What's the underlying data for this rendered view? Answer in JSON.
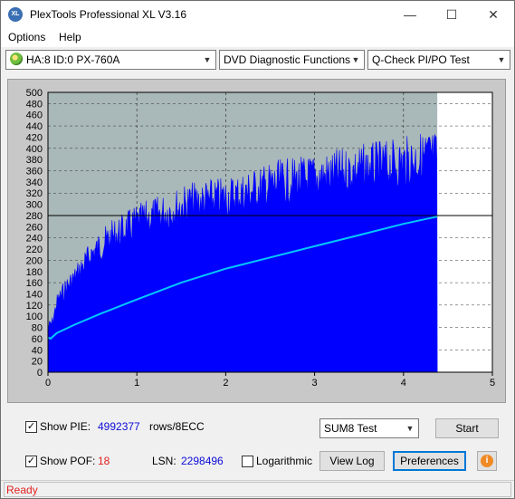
{
  "window": {
    "title": "PlexTools Professional XL V3.16",
    "icon_text": "XL",
    "minimize_glyph": "—",
    "maximize_glyph": "☐",
    "close_glyph": "✕"
  },
  "menu": {
    "items": [
      "Options",
      "Help"
    ]
  },
  "toolbar": {
    "drive": "HA:8 ID:0  PX-760A",
    "function": "DVD Diagnostic Functions",
    "test": "Q-Check PI/PO Test"
  },
  "chart_data": {
    "type": "area",
    "x_ticks": [
      "0",
      "1",
      "2",
      "3",
      "4",
      "5"
    ],
    "y_ticks": [
      "0",
      "20",
      "40",
      "60",
      "80",
      "100",
      "120",
      "140",
      "160",
      "180",
      "200",
      "220",
      "240",
      "260",
      "280",
      "300",
      "320",
      "340",
      "360",
      "380",
      "400",
      "420",
      "440",
      "460",
      "480",
      "500"
    ],
    "xlim": [
      0,
      5
    ],
    "ylim": [
      0,
      500
    ],
    "threshold": 280,
    "data_end_x": 4.38,
    "series": [
      {
        "color": "#0000ff",
        "x": [
          0.0,
          0.05,
          0.1,
          0.2,
          0.3,
          0.5,
          0.7,
          1.0,
          1.3,
          1.6,
          2.0,
          2.3,
          2.6,
          3.0,
          3.3,
          3.6,
          4.0,
          4.2,
          4.3,
          4.38
        ],
        "values": [
          90,
          100,
          140,
          170,
          190,
          240,
          270,
          300,
          320,
          340,
          350,
          365,
          380,
          390,
          400,
          410,
          420,
          430,
          435,
          430
        ]
      },
      {
        "color": "#00c8ff",
        "x": [
          0.0,
          0.03,
          0.1,
          0.3,
          0.6,
          1.0,
          1.5,
          2.0,
          2.5,
          3.0,
          3.5,
          4.0,
          4.38
        ],
        "values": [
          62,
          60,
          70,
          85,
          105,
          130,
          160,
          185,
          205,
          225,
          245,
          265,
          278
        ]
      }
    ]
  },
  "controls": {
    "show_pie_label": "Show PIE:",
    "show_pie_checked": true,
    "pie_value": "4992377",
    "pie_unit": "rows/8ECC",
    "show_pof_label": "Show POF:",
    "show_pof_checked": true,
    "pof_value": "18",
    "lsn_label": "LSN:",
    "lsn_value": "2298496",
    "log_label": "Logarithmic",
    "log_checked": false,
    "sum_select": "SUM8 Test",
    "start_button": "Start",
    "view_log_button": "View Log",
    "preferences_button": "Preferences",
    "info_glyph": "i",
    "check_glyph": "✓"
  },
  "status": {
    "text": "Ready"
  }
}
